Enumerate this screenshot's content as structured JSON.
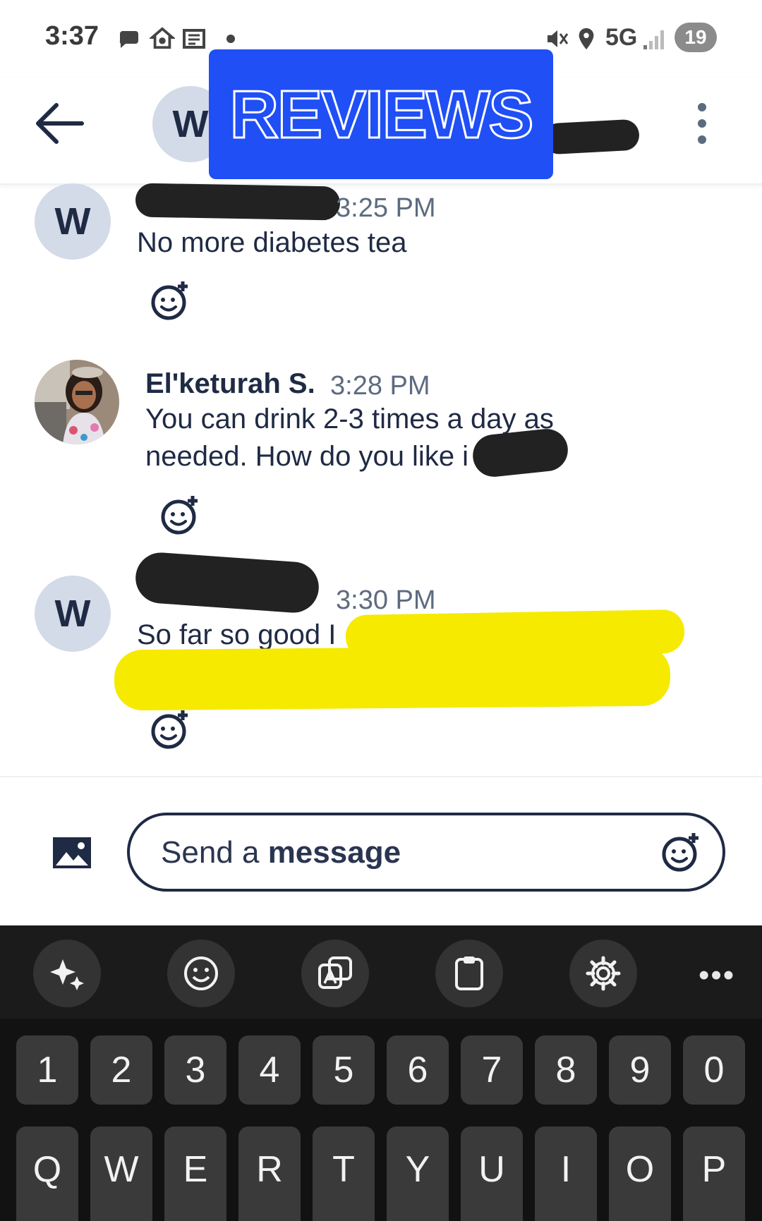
{
  "status_bar": {
    "time": "3:37",
    "network": "5G",
    "battery": "19"
  },
  "header": {
    "avatar_letter": "W",
    "banner_text": "REVIEWS"
  },
  "messages": [
    {
      "avatar_letter": "W",
      "time": "3:25 PM",
      "text": "No more diabetes tea"
    },
    {
      "sender": "El'keturah S.",
      "time": "3:28 PM",
      "text_line1": "You can drink 2-3 times a day as",
      "text_line2": "needed. How do you like i"
    },
    {
      "avatar_letter": "W",
      "time": "3:30 PM",
      "text": "So far so good I"
    }
  ],
  "composer": {
    "placeholder_part1": "Send a ",
    "placeholder_part2": "message"
  },
  "keyboard": {
    "more_label": "•••",
    "number_row": [
      "1",
      "2",
      "3",
      "4",
      "5",
      "6",
      "7",
      "8",
      "9",
      "0"
    ],
    "letter_row": [
      "Q",
      "W",
      "E",
      "R",
      "T",
      "Y",
      "U",
      "I",
      "O",
      "P"
    ]
  },
  "colors": {
    "banner": "#1f4ff5",
    "highlight": "#f5ea00",
    "ink": "#1f2a44",
    "avatar_bg": "#d3dae8"
  }
}
